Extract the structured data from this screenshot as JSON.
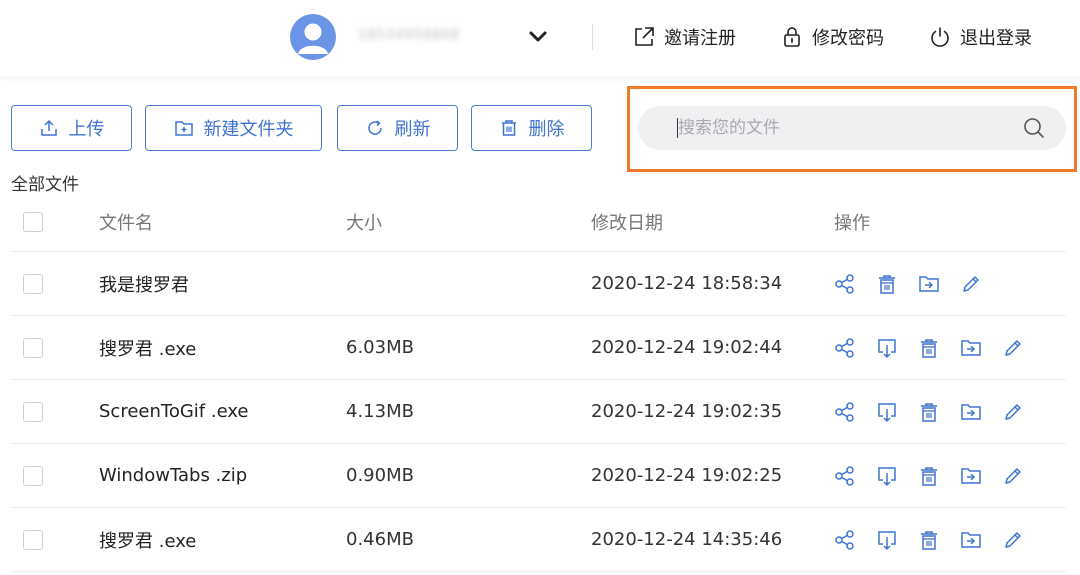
{
  "header": {
    "username": "18534958868",
    "invite_label": "邀请注册",
    "password_label": "修改密码",
    "logout_label": "退出登录"
  },
  "toolbar": {
    "upload_label": "上传",
    "new_folder_label": "新建文件夹",
    "refresh_label": "刷新",
    "delete_label": "删除"
  },
  "search": {
    "placeholder": "搜索您的文件"
  },
  "breadcrumb": "全部文件",
  "table": {
    "columns": {
      "name": "文件名",
      "size": "大小",
      "date": "修改日期",
      "ops": "操作"
    },
    "rows": [
      {
        "name": "我是搜罗君",
        "size": "",
        "date": "2020-12-24 18:58:34"
      },
      {
        "name": "搜罗君 .exe",
        "size": "6.03MB",
        "date": "2020-12-24 19:02:44"
      },
      {
        "name": "ScreenToGif .exe",
        "size": "4.13MB",
        "date": "2020-12-24 19:02:35"
      },
      {
        "name": "WindowTabs .zip",
        "size": "0.90MB",
        "date": "2020-12-24 19:02:25"
      },
      {
        "name": "搜罗君 .exe",
        "size": "0.46MB",
        "date": "2020-12-24 14:35:46"
      }
    ]
  },
  "colors": {
    "accent": "#3f73cf",
    "highlight": "#ef7a2a",
    "search_bg": "#f0f0f2"
  }
}
